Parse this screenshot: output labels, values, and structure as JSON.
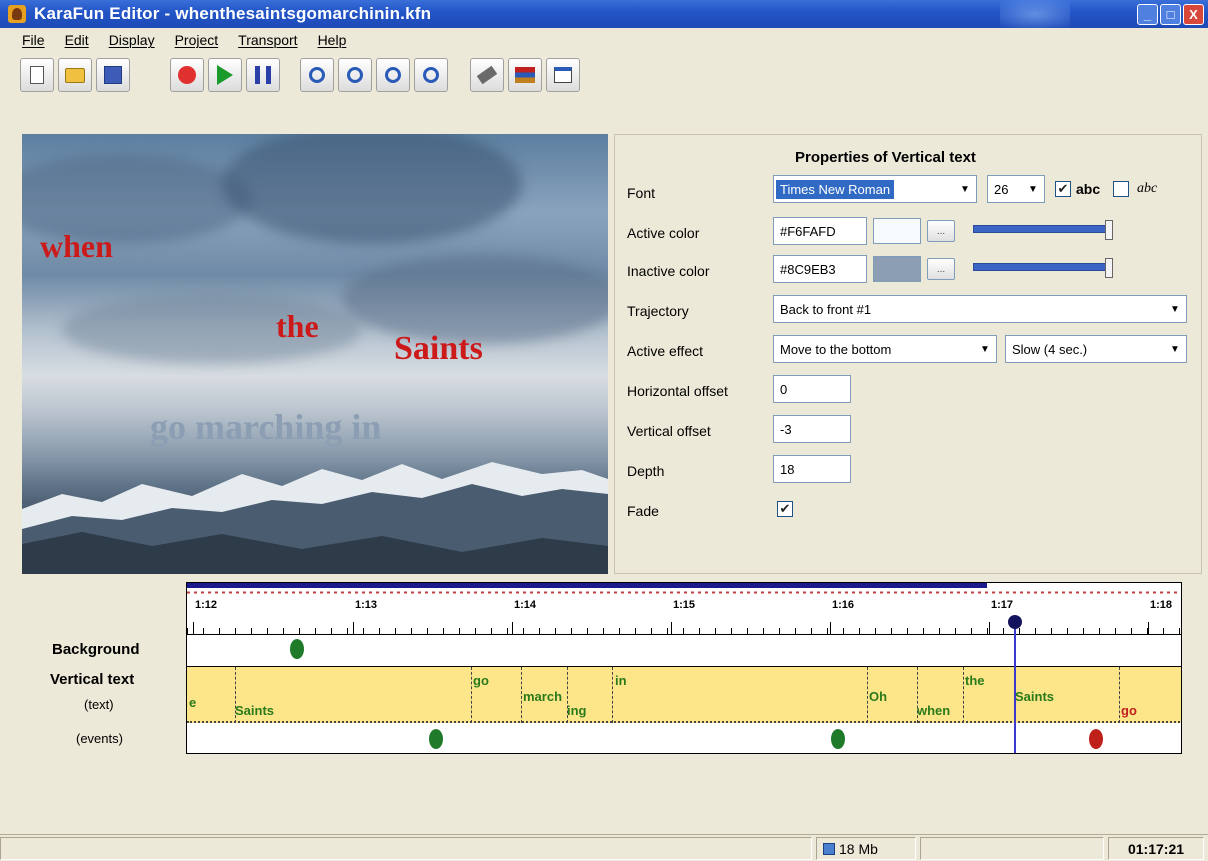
{
  "window": {
    "title": "KaraFun Editor - whenthesaintsgomarchinin.kfn",
    "buttons": [
      "_",
      "□",
      "X"
    ]
  },
  "menu": [
    "File",
    "Edit",
    "Display",
    "Project",
    "Transport",
    "Help"
  ],
  "toolbar": {
    "buttons": [
      {
        "name": "new-document-icon",
        "glyph": "🗋"
      },
      {
        "name": "open-folder-icon",
        "glyph": "📂"
      },
      {
        "name": "save-icon",
        "glyph": "💾"
      },
      {
        "name": "record-icon",
        "glyph": "●",
        "color": "#e03030"
      },
      {
        "name": "play-icon",
        "glyph": "▶",
        "color": "#1a9a2a"
      },
      {
        "name": "pause-icon",
        "glyph": "❚❚",
        "color": "#2b3fa8"
      },
      {
        "name": "zoom-in-icon",
        "glyph": "🔍"
      },
      {
        "name": "zoom-out-icon",
        "glyph": "🔍"
      },
      {
        "name": "zoom-fit-icon",
        "glyph": "🔍"
      },
      {
        "name": "zoom-reset-icon",
        "glyph": "🔍"
      },
      {
        "name": "tools-icon",
        "glyph": "⚙"
      },
      {
        "name": "library-icon",
        "glyph": "📚"
      },
      {
        "name": "properties-icon",
        "glyph": "🗔"
      }
    ]
  },
  "preview": {
    "words": [
      {
        "text": "when",
        "color": "#cc1a1a"
      },
      {
        "text": "the",
        "color": "#cc1a1a"
      },
      {
        "text": "Saints",
        "color": "#cc1a1a"
      },
      {
        "text": "go marching in",
        "color": "#8c9eb3"
      }
    ]
  },
  "properties": {
    "title": "Properties of Vertical text",
    "font_label": "Font",
    "font_value": "Times New Roman",
    "font_size": "26",
    "style_bold_label": "abc",
    "style_italic_label": "abc",
    "style_bold_checked": true,
    "style_italic_checked": false,
    "active_color_label": "Active color",
    "active_color_value": "#F6FAFD",
    "active_color_swatch": "#f6fafd",
    "inactive_color_label": "Inactive color",
    "inactive_color_value": "#8C9EB3",
    "inactive_color_swatch": "#8c9eb3",
    "ellipsis": "...",
    "trajectory_label": "Trajectory",
    "trajectory_value": "Back to front #1",
    "active_effect_label": "Active effect",
    "active_effect_value": "Move to the bottom",
    "active_effect_speed": "Slow (4 sec.)",
    "h_offset_label": "Horizontal offset",
    "h_offset_value": "0",
    "v_offset_label": "Vertical offset",
    "v_offset_value": "-3",
    "depth_label": "Depth",
    "depth_value": "18",
    "fade_label": "Fade",
    "fade_checked": true
  },
  "timeline": {
    "row_labels": {
      "background": "Background",
      "vertical_text": "Vertical text",
      "text": "(text)",
      "events": "(events)"
    },
    "ticks": [
      "1:12",
      "1:13",
      "1:14",
      "1:15",
      "1:16",
      "1:17",
      "1:18"
    ],
    "words": [
      {
        "text": "e",
        "row": "low"
      },
      {
        "text": "Saints",
        "row": "low"
      },
      {
        "text": "go",
        "row": "high"
      },
      {
        "text": "march",
        "row": "mid"
      },
      {
        "text": "ing",
        "row": "low"
      },
      {
        "text": "in",
        "row": "high"
      },
      {
        "text": "Oh",
        "row": "mid"
      },
      {
        "text": "when",
        "row": "low"
      },
      {
        "text": "the",
        "row": "high"
      },
      {
        "text": "Saints",
        "row": "mid"
      },
      {
        "text": "go",
        "row": "low",
        "color": "#c02020"
      }
    ],
    "event_dot_colors": [
      "#1f7a2a",
      "#1f7a2a",
      "#1f7a2a",
      "#c0201a"
    ],
    "cursor_color": "#3a3acc"
  },
  "status": {
    "memory": "18 Mb",
    "time": "01:17:21"
  }
}
